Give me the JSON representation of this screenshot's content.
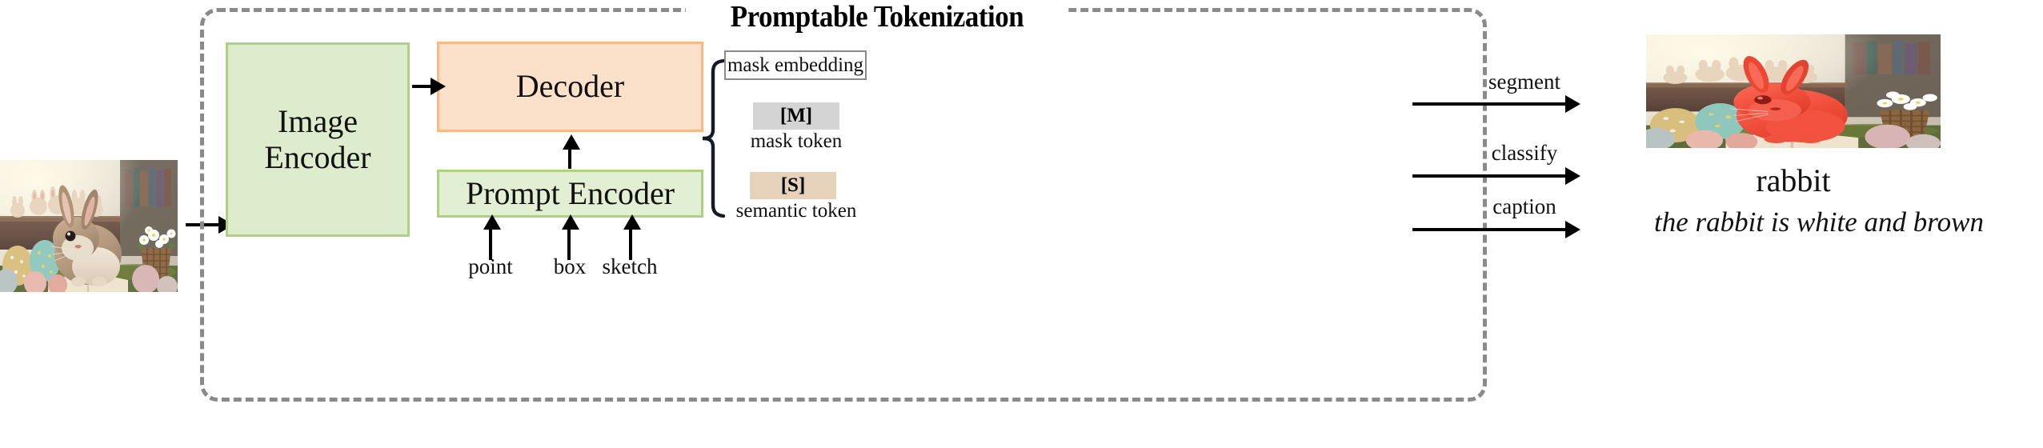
{
  "diagram": {
    "title": "Promptable Tokenization",
    "nodes": {
      "image_encoder": "Image\nEncoder",
      "image_encoder_line1": "Image",
      "image_encoder_line2": "Encoder",
      "decoder": "Decoder",
      "prompt_encoder": "Prompt Encoder"
    },
    "tokens": {
      "mask_embedding": "mask embedding",
      "mask_chip": "[M]",
      "mask_token_label": "mask token",
      "semantic_chip": "[S]",
      "semantic_token_label": "semantic token"
    },
    "prompt_inputs": [
      {
        "label": "point"
      },
      {
        "label": "box"
      },
      {
        "label": "sketch"
      }
    ],
    "task_edges": [
      {
        "label": "segment"
      },
      {
        "label": "classify"
      },
      {
        "label": "caption"
      }
    ],
    "outputs": {
      "segmentation_alt": "rabbit highlighted in red over easter scene",
      "classification": "rabbit",
      "caption": "the rabbit is white and brown"
    },
    "input_image_alt": "brown and white rabbit with easter eggs and basket",
    "colors": {
      "encoder_fill": "#ddeccc",
      "encoder_border": "#aed082",
      "decoder_fill": "#fbe0ca",
      "decoder_border": "#f6b989",
      "mask_chip_fill": "#d4d4d4",
      "semantic_chip_fill": "#e6d2ba",
      "dashed_border": "#8a8a8a",
      "segment_highlight": "#f04a3c"
    }
  }
}
